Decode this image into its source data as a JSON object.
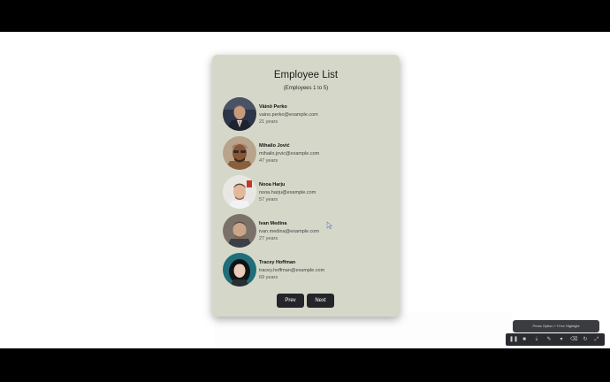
{
  "card": {
    "title": "Employee List",
    "subtitle": "(Employees 1 to 5)"
  },
  "employees": [
    {
      "name": "Väinö Perko",
      "email": "vaino.perko@example.com",
      "age": "21 years"
    },
    {
      "name": "Mihailo Jović",
      "email": "mihailo.jovic@example.com",
      "age": "47 years"
    },
    {
      "name": "Nooa Harju",
      "email": "nooa.harju@example.com",
      "age": "57 years"
    },
    {
      "name": "Ivan Medina",
      "email": "ivan.medina@example.com",
      "age": "27 years"
    },
    {
      "name": "Tracey Hoffman",
      "email": "tracey.hoffman@example.com",
      "age": "69 years"
    }
  ],
  "pagination": {
    "prev_label": "Prev",
    "next_label": "Next"
  },
  "recorder": {
    "tooltip": "Press Option + H for Highlight",
    "icons": [
      "pause-icon",
      "stop-icon",
      "pointer-icon",
      "pen-icon",
      "highlighter-icon",
      "eraser-icon",
      "undo-icon",
      "collapse-icon"
    ]
  },
  "colors": {
    "card_bg": "#d5d8c9",
    "button_bg": "#23252a"
  }
}
